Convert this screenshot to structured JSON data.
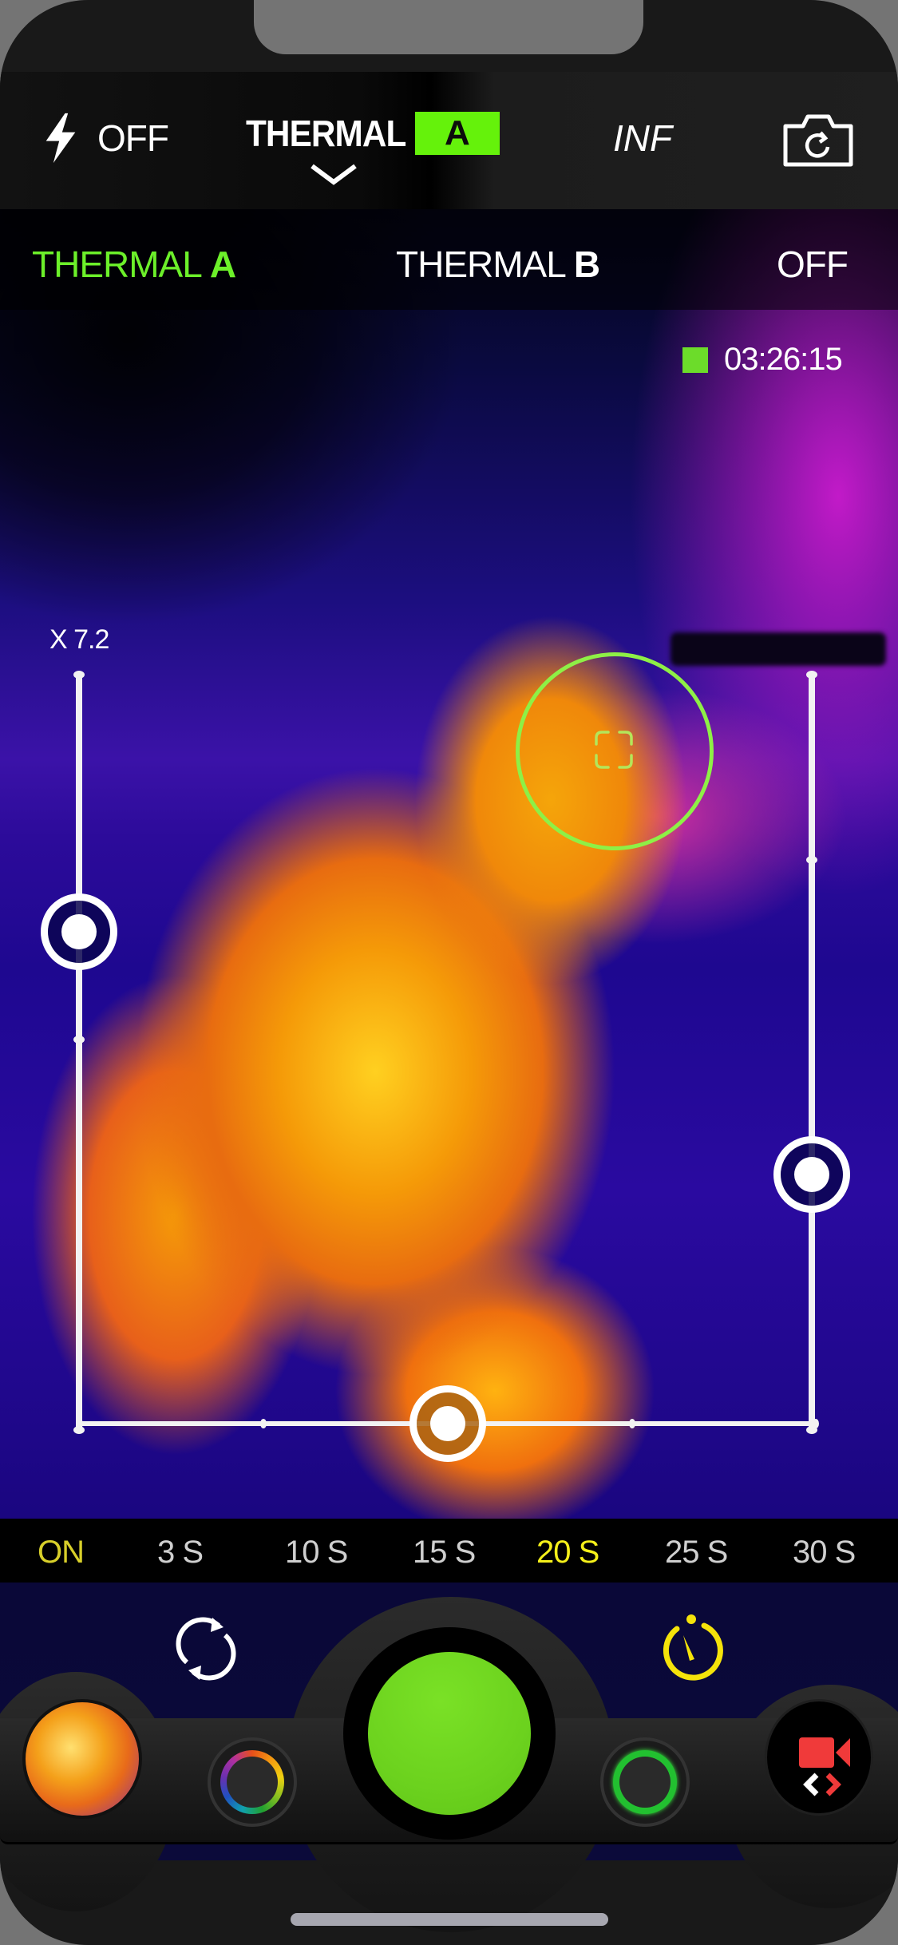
{
  "toolbar": {
    "flash_icon": "flash-icon",
    "flash_label": "OFF",
    "mode_title": "THERMAL",
    "mode_badge": "A",
    "dropdown_icon": "chevron-down-icon",
    "focus_label": "INF",
    "camera_switch_icon": "camera-rotate-icon"
  },
  "mode_selector": {
    "options": [
      {
        "prefix": "THERMAL ",
        "suffix": "A",
        "selected": true
      },
      {
        "prefix": "THERMAL ",
        "suffix": "B",
        "selected": false
      },
      {
        "prefix": "OFF",
        "suffix": "",
        "selected": false
      }
    ]
  },
  "recording": {
    "indicator_color": "#6cdc2a",
    "time": "03:26:15"
  },
  "zoom": {
    "label": "X 7.2"
  },
  "sliders": {
    "zoom_level_fraction": 0.34,
    "right_level_fraction": 0.66,
    "horizontal_level_fraction": 0.5
  },
  "timer": {
    "options": [
      {
        "label": "ON",
        "state": "on"
      },
      {
        "label": "3 S",
        "state": ""
      },
      {
        "label": "10 S",
        "state": ""
      },
      {
        "label": "15 S",
        "state": ""
      },
      {
        "label": "20 S",
        "state": "selected"
      },
      {
        "label": "25 S",
        "state": ""
      },
      {
        "label": "30 S",
        "state": ""
      }
    ]
  },
  "controls": {
    "sync_icon": "sync-icon",
    "timer_icon": "timer-icon",
    "shutter_color": "#6cd21e",
    "palette_icon": "color-palette-icon",
    "green_filter_icon": "green-filter-icon",
    "gallery_thumbnail": "gallery-thumbnail",
    "video_switch_icon": "video-camera-icon"
  },
  "colors": {
    "accent_green": "#65f20b",
    "timer_selected": "#f5f01a",
    "timer_on": "#d8cf2a",
    "video_red": "#f03a3a"
  }
}
